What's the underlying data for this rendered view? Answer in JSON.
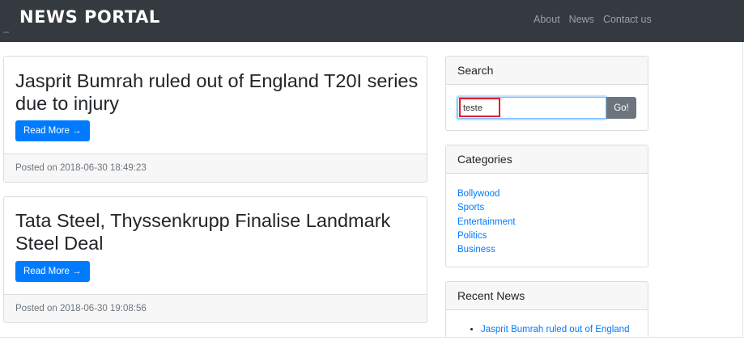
{
  "navbar": {
    "brand": "NEWS PORTAL",
    "links": [
      "About",
      "News",
      "Contact us"
    ]
  },
  "posts": [
    {
      "title": "Jasprit Bumrah ruled out of England T20I series due to injury",
      "read_more": "Read More →",
      "posted": "Posted on 2018-06-30 18:49:23"
    },
    {
      "title": "Tata Steel, Thyssenkrupp Finalise Landmark Steel Deal",
      "read_more": "Read More →",
      "posted": "Posted on 2018-06-30 19:08:56"
    }
  ],
  "sidebar": {
    "search": {
      "title": "Search",
      "value": "teste",
      "button": "Go!"
    },
    "categories": {
      "title": "Categories",
      "items": [
        "Bollywood",
        "Sports",
        "Entertainment",
        "Politics",
        "Business"
      ]
    },
    "recent": {
      "title": "Recent News",
      "items": [
        "Jasprit Bumrah ruled out of England"
      ]
    }
  },
  "colors": {
    "navbar": "#343a40",
    "primary": "#007bff",
    "secondary": "#6c757d",
    "highlight": "#e01e2b"
  }
}
